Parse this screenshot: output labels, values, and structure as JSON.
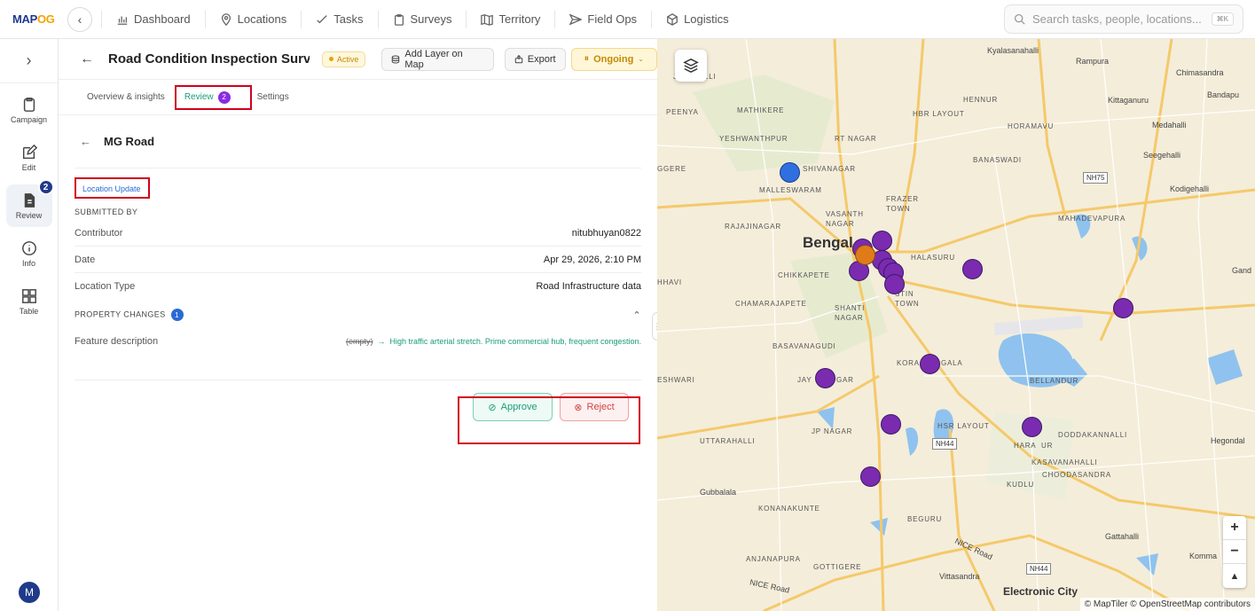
{
  "app": {
    "logo_main": "MAP",
    "logo_accent": "OG"
  },
  "nav": {
    "items": [
      {
        "label": "Dashboard",
        "icon": "chart-icon"
      },
      {
        "label": "Locations",
        "icon": "pin-icon"
      },
      {
        "label": "Tasks",
        "icon": "check-icon"
      },
      {
        "label": "Surveys",
        "icon": "clipboard-icon"
      },
      {
        "label": "Territory",
        "icon": "map-icon"
      },
      {
        "label": "Field Ops",
        "icon": "send-icon"
      },
      {
        "label": "Logistics",
        "icon": "box-icon"
      }
    ],
    "search_placeholder": "Search tasks, people, locations...",
    "search_shortcut": "⌘K"
  },
  "rail": {
    "items": [
      {
        "label": "Campaign"
      },
      {
        "label": "Edit"
      },
      {
        "label": "Review",
        "badge": "2"
      },
      {
        "label": "Info"
      },
      {
        "label": "Table"
      }
    ],
    "avatar_initial": "M"
  },
  "header": {
    "title": "Road Condition Inspection Surve...",
    "status": "Active",
    "add_layer": "Add Layer on Map",
    "export": "Export",
    "ongoing": "Ongoing"
  },
  "tabs": [
    {
      "label": "Overview & insights"
    },
    {
      "label": "Review",
      "badge": "2"
    },
    {
      "label": "Settings"
    }
  ],
  "detail": {
    "name": "MG Road",
    "tag": "Location Update",
    "submitted_by_label": "SUBMITTED BY",
    "rows": [
      {
        "key": "Contributor",
        "value": "nitubhuyan0822"
      },
      {
        "key": "Date",
        "value": "Apr 29, 2026, 2:10 PM"
      },
      {
        "key": "Location Type",
        "value": "Road Infrastructure data"
      }
    ],
    "property_changes_label": "PROPERTY CHANGES",
    "property_changes_count": "1",
    "change": {
      "key": "Feature description",
      "old": "(empty)",
      "arrow": "→",
      "new": "High traffic arterial stretch. Prime commercial hub, frequent congestion."
    },
    "approve": "Approve",
    "reject": "Reject"
  },
  "map": {
    "labels": {
      "jalahalli": "JALAHALLI",
      "peenya": "PEENYA",
      "mathikere": "MATHIKERE",
      "yeshwanthpur": "YESHWANTHPUR",
      "rt_nagar": "RT NAGAR",
      "hebbal_layout": "HBR LAYOUT",
      "hennur": "HENNUR",
      "horamavu": "HORAMAVU",
      "kyalasanahalli": "Kyalasanahalli",
      "rampura": "Rampura",
      "chimasandra": "Chimasandra",
      "kittaganuru": "Kittaganuru",
      "bandapura": "Bandapu",
      "medahalli": "Medahalli",
      "seegehalli": "Seegehalli",
      "kodigehalli": "Kodigehalli",
      "banaswadi": "BANASWADI",
      "mahadevapura": "MAHADEVAPURA",
      "malleswaram": "MALLESWARAM",
      "sheshivanagar": "SHIVANAGAR",
      "rajajinagar": "RAJAJINAGAR",
      "vasanth_nagar": "VASANTH\nNAGAR",
      "frazer_town": "FRAZER\nTOWN",
      "bengaluru": "Bengal",
      "halasuru": "HALASURU",
      "chikkapete": "CHIKKAPETE",
      "chamarajapete": "CHAMARAJAPETE",
      "shanti_nagar": "SHANTI\nNAGAR",
      "austin_town": "STIN\nTOWN",
      "hhavi": "HHAVI",
      "ggere": "GGERE",
      "basavanagudi": "BASAVANAGUDI",
      "jayanagar_left": "JAY",
      "jayanagar_right": "GAR",
      "koramangala_left": "KORA",
      "koramangala_right": "GALA",
      "eshwari": "ESHWARI",
      "bellanduru": "BELLANDUR",
      "jp_nagar": "JP NAGAR",
      "hsr_layout": "HSR LAYOUT",
      "uttarahalli": "UTTARAHALLI",
      "doddakannalli": "DODDAKANNALLI",
      "harlur": "HARA",
      "harlur2": "UR",
      "kasavanahalli": "KASAVANAHALLI",
      "choodasandra": "CHOODASANDRA",
      "hegondahalli": "Hegondal",
      "kudlu": "KUDLU",
      "gubbalala": "Gubbalala",
      "konanakunte": "KONANAKUNTE",
      "beguru": "BEGURU",
      "gattahalli": "Gattahalli",
      "kommasandra": "Komma",
      "anjanapura": "ANJANAPURA",
      "gottigere": "GOTTIGERE",
      "vittasandra": "Vittasandra",
      "electronic_city": "Electronic City",
      "ganda": "Gand",
      "nice_road": "NICE Road",
      "nice_road2": "NICE Road"
    },
    "shields": {
      "nh75": "NH75",
      "nh44": "NH44",
      "nh44b": "NH44"
    },
    "zoom_in": "+",
    "zoom_out": "−",
    "compass": "▲",
    "attribution": "© MapTiler © OpenStreetMap contributors"
  }
}
